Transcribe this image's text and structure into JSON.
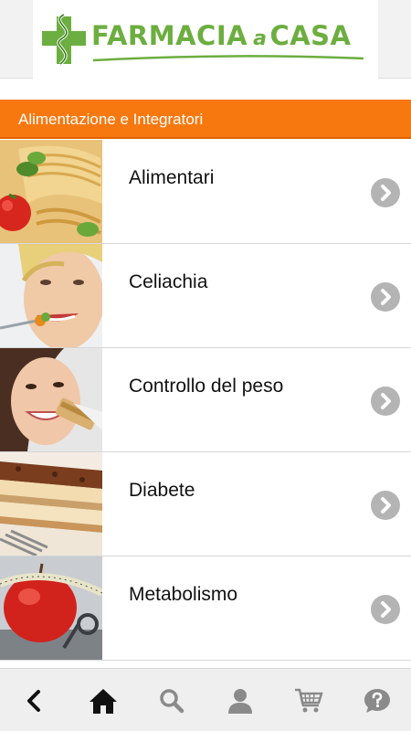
{
  "header": {
    "logo_text_1": "FARMACIA",
    "logo_text_a": "a",
    "logo_text_2": "CASA",
    "brand_color": "#6cae3f"
  },
  "category": {
    "title": "Alimentazione e Integratori",
    "color": "#f7780f"
  },
  "items": [
    {
      "label": "Alimentari",
      "icon": "pasta-photo"
    },
    {
      "label": "Celiachia",
      "icon": "woman-eating-photo"
    },
    {
      "label": "Controllo del peso",
      "icon": "woman-snack-bar-photo"
    },
    {
      "label": "Diabete",
      "icon": "cake-slice-photo"
    },
    {
      "label": "Metabolismo",
      "icon": "apple-tape-measure-photo"
    }
  ],
  "bottom_nav": [
    {
      "icon": "back-arrow-icon"
    },
    {
      "icon": "home-icon"
    },
    {
      "icon": "search-icon"
    },
    {
      "icon": "account-icon"
    },
    {
      "icon": "cart-icon"
    },
    {
      "icon": "help-icon"
    }
  ]
}
